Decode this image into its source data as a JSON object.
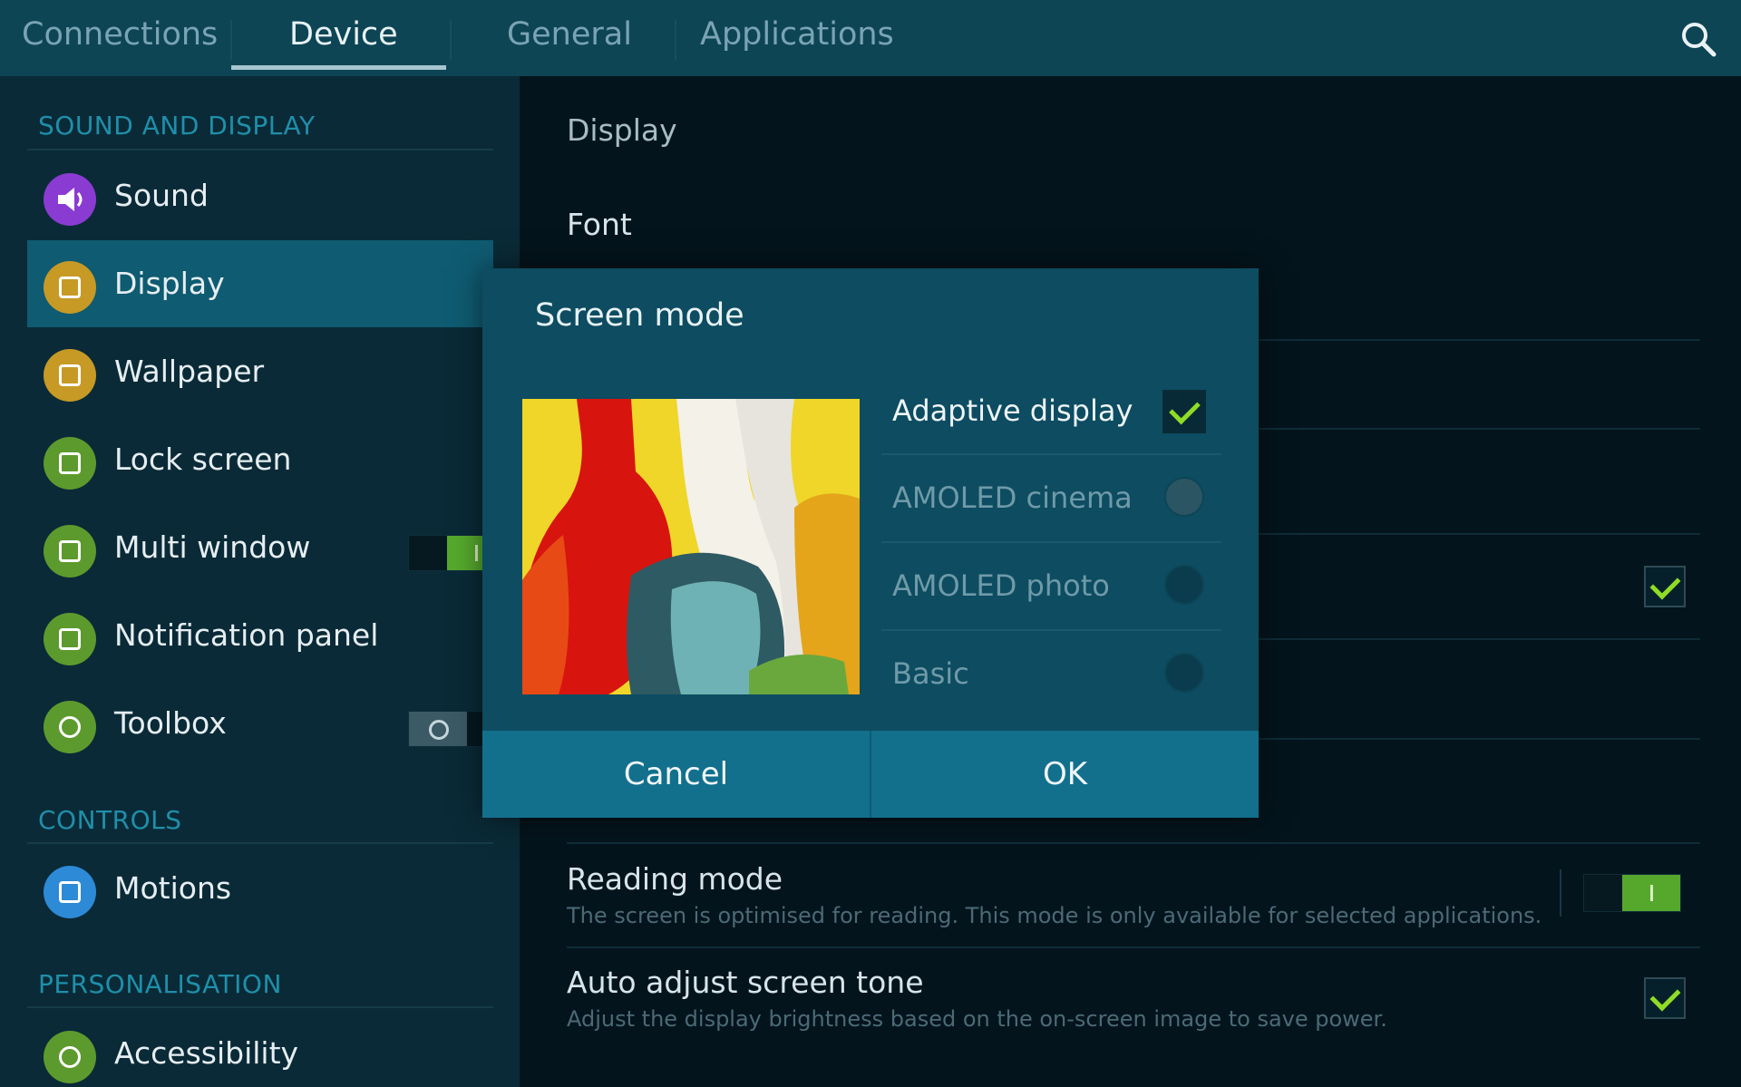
{
  "tabs": [
    {
      "label": "Connections"
    },
    {
      "label": "Device"
    },
    {
      "label": "General"
    },
    {
      "label": "Applications"
    }
  ],
  "active_tab": "Device",
  "sidebar": {
    "sections": [
      {
        "title": "SOUND AND DISPLAY"
      },
      {
        "title": "CONTROLS"
      },
      {
        "title": "PERSONALISATION"
      }
    ],
    "items": [
      {
        "label": "Sound",
        "icon": "speaker-icon",
        "color": "#8a3bd1"
      },
      {
        "label": "Display",
        "icon": "display-icon",
        "color": "#c69a25",
        "selected": true
      },
      {
        "label": "Wallpaper",
        "icon": "wallpaper-icon",
        "color": "#c69a25"
      },
      {
        "label": "Lock screen",
        "icon": "lock-screen-icon",
        "color": "#5d9a2e"
      },
      {
        "label": "Multi window",
        "icon": "multi-window-icon",
        "color": "#5d9a2e",
        "toggle": "on"
      },
      {
        "label": "Notification panel",
        "icon": "notification-panel-icon",
        "color": "#5d9a2e"
      },
      {
        "label": "Toolbox",
        "icon": "toolbox-icon",
        "color": "#5d9a2e",
        "toggle": "off"
      },
      {
        "label": "Motions",
        "icon": "motions-icon",
        "color": "#2d8ad6"
      },
      {
        "label": "Accessibility",
        "icon": "accessibility-icon",
        "color": "#5d9a2e"
      }
    ]
  },
  "content": {
    "header": "Display",
    "font_label": "Font",
    "reading_mode": {
      "title": "Reading mode",
      "subtitle": "The screen is optimised for reading. This mode is only available for selected applications."
    },
    "auto_tone": {
      "title": "Auto adjust screen tone",
      "subtitle": "Adjust the display brightness based on the on-screen image to save power."
    }
  },
  "dialog": {
    "title": "Screen mode",
    "options": [
      {
        "label": "Adaptive display",
        "type": "checkbox",
        "checked": true
      },
      {
        "label": "AMOLED cinema",
        "type": "radio",
        "selected": true
      },
      {
        "label": "AMOLED photo",
        "type": "radio"
      },
      {
        "label": "Basic",
        "type": "radio"
      }
    ],
    "cancel_label": "Cancel",
    "ok_label": "OK"
  },
  "colors": {
    "accent_green": "#8fdc27",
    "toggle_green": "#56a82d",
    "section_header": "#1f8fa9",
    "tabbar": "#0d4555",
    "dialog_bg": "#0d4c61",
    "dialog_button": "#12708d"
  }
}
